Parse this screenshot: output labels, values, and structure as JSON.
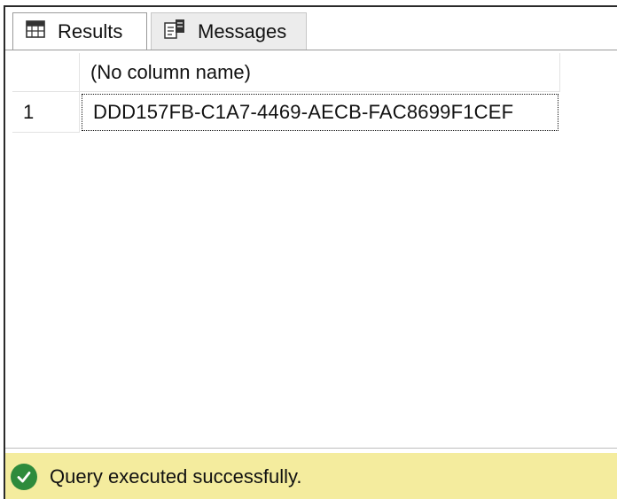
{
  "tabs": [
    {
      "label": "Results",
      "icon": "grid-icon",
      "active": true
    },
    {
      "label": "Messages",
      "icon": "messages-icon",
      "active": false
    }
  ],
  "grid": {
    "columns": [
      "(No column name)"
    ],
    "rows": [
      {
        "num": "1",
        "values": [
          "DDD157FB-C1A7-4469-AECB-FAC8699F1CEF"
        ]
      }
    ]
  },
  "status": {
    "text": "Query executed successfully.",
    "icon": "success-check-icon",
    "color": "#2e8b3c",
    "bar_color": "#f4ec9e"
  }
}
